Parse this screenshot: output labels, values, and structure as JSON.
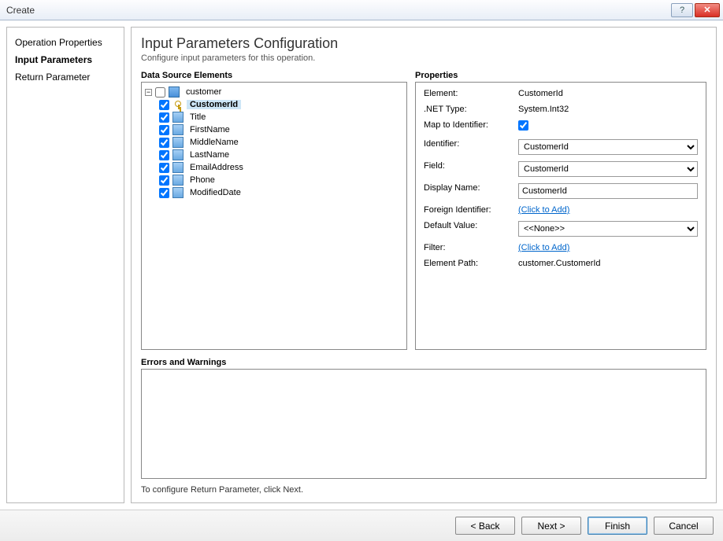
{
  "window": {
    "title": "Create"
  },
  "sidebar": {
    "items": [
      {
        "label": "Operation Properties",
        "active": false
      },
      {
        "label": "Input Parameters",
        "active": true
      },
      {
        "label": "Return Parameter",
        "active": false
      }
    ]
  },
  "main": {
    "title": "Input Parameters Configuration",
    "subtitle": "Configure input parameters for this operation.",
    "dataSourceLabel": "Data Source Elements",
    "propertiesLabel": "Properties",
    "errorsLabel": "Errors and Warnings",
    "footerHint": "To configure Return Parameter, click Next."
  },
  "tree": {
    "root": {
      "label": "customer",
      "checked": false,
      "children": [
        {
          "label": "CustomerId",
          "checked": true,
          "icon": "key",
          "selected": true
        },
        {
          "label": "Title",
          "checked": true,
          "icon": "col"
        },
        {
          "label": "FirstName",
          "checked": true,
          "icon": "col"
        },
        {
          "label": "MiddleName",
          "checked": true,
          "icon": "col"
        },
        {
          "label": "LastName",
          "checked": true,
          "icon": "col"
        },
        {
          "label": "EmailAddress",
          "checked": true,
          "icon": "col"
        },
        {
          "label": "Phone",
          "checked": true,
          "icon": "col"
        },
        {
          "label": "ModifiedDate",
          "checked": true,
          "icon": "col"
        }
      ]
    }
  },
  "props": {
    "elementLabel": "Element:",
    "elementValue": "CustomerId",
    "netTypeLabel": ".NET Type:",
    "netTypeValue": "System.Int32",
    "mapLabel": "Map to Identifier:",
    "mapChecked": true,
    "identifierLabel": "Identifier:",
    "identifierValue": "CustomerId",
    "fieldLabel": "Field:",
    "fieldValue": "CustomerId",
    "displayNameLabel": "Display Name:",
    "displayNameValue": "CustomerId",
    "foreignIdLabel": "Foreign Identifier:",
    "foreignIdLink": "(Click to Add)",
    "defaultValueLabel": "Default Value:",
    "defaultValueValue": "<<None>>",
    "filterLabel": "Filter:",
    "filterLink": "(Click to Add)",
    "elementPathLabel": "Element Path:",
    "elementPathValue": "customer.CustomerId"
  },
  "buttons": {
    "back": "< Back",
    "next": "Next >",
    "finish": "Finish",
    "cancel": "Cancel"
  }
}
